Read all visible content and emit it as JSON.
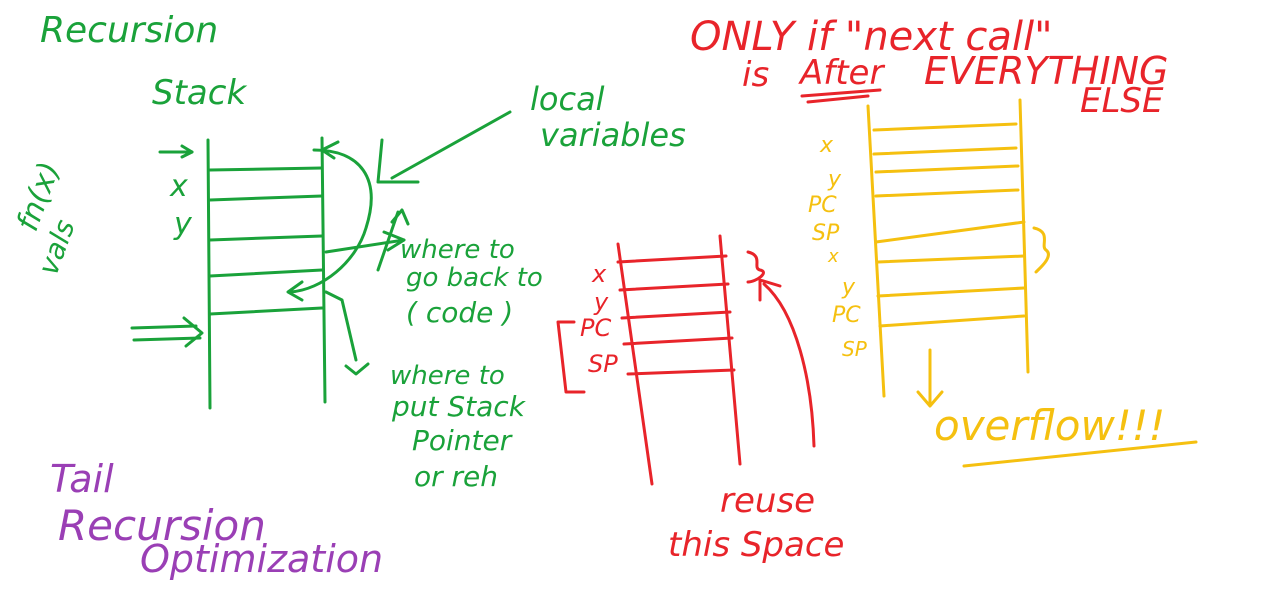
{
  "green": {
    "title": "Recursion",
    "subtitle": "Stack",
    "fn_call": "fn(x)",
    "fn_vals": "vals",
    "slot_x": "x",
    "slot_y": "y",
    "local_variables": "local variables",
    "where_back": [
      "where to",
      "go back to",
      "( code )"
    ],
    "where_sp": [
      "where to",
      "put Stack",
      "Pointer",
      "or reh"
    ]
  },
  "purple": {
    "lines": [
      "Tail",
      "Recursion",
      "Optimization"
    ]
  },
  "red": {
    "slot_labels": [
      "x",
      "y",
      "PC",
      "SP"
    ],
    "reuse": [
      "reuse",
      "this Space"
    ],
    "heading_1": "ONLY if \"next call\"",
    "heading_2_prefix": "is",
    "heading_2_after": "After",
    "heading_2_suffix": "EVERYTHING",
    "heading_3": "ELSE"
  },
  "yellow": {
    "slot_labels": [
      "x",
      "y",
      "PC",
      "SP",
      "x",
      "y",
      "PC",
      "SP"
    ],
    "overflow": "overflow!!!"
  },
  "colors": {
    "green": "#1aa23a",
    "red": "#e8242a",
    "yellow": "#f5c010",
    "purple": "#9a3fb5"
  }
}
